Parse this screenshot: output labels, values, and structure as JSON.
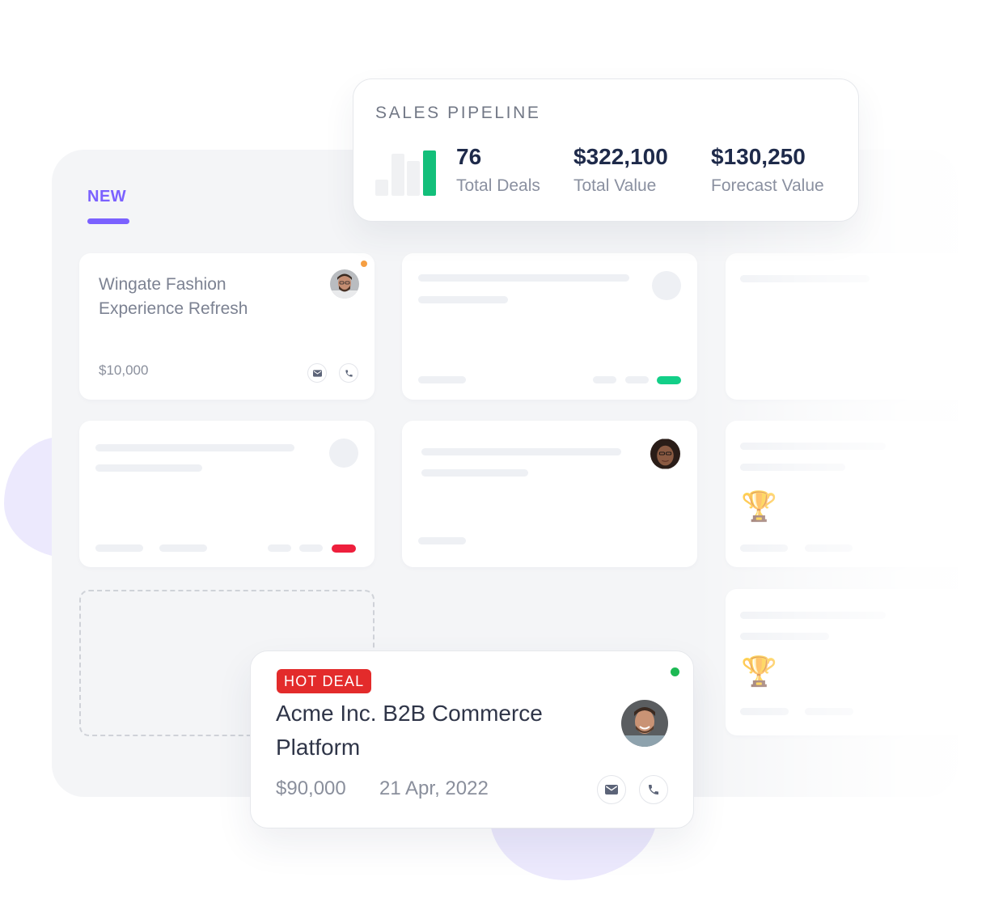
{
  "colors": {
    "accent": "#7b61ff",
    "success": "#13bf7a",
    "danger": "#e32b2b",
    "warning": "#f59e42",
    "online": "#1db954"
  },
  "pipeline": {
    "title": "SALES PIPELINE",
    "bars": [
      {
        "value": 0.36,
        "highlight": false
      },
      {
        "value": 0.93,
        "highlight": false
      },
      {
        "value": 0.77,
        "highlight": false
      },
      {
        "value": 1.0,
        "highlight": true
      }
    ],
    "stats": [
      {
        "value": "76",
        "label": "Total Deals"
      },
      {
        "value": "$322,100",
        "label": "Total Value"
      },
      {
        "value": "$130,250",
        "label": "Forecast Value"
      }
    ]
  },
  "board": {
    "column_title": "NEW",
    "cards": [
      {
        "title": "Wingate Fashion Experience Refresh",
        "amount": "$10,000",
        "status": "warning",
        "icons": [
          "mail-icon",
          "phone-icon"
        ]
      }
    ],
    "placeholder_statuses": [
      "success",
      "danger"
    ],
    "trophy_icon": "🏆"
  },
  "hot_deal": {
    "badge": "HOT DEAL",
    "title": "Acme Inc. B2B Commerce Platform",
    "amount": "$90,000",
    "date": "21 Apr, 2022",
    "status": "online",
    "icons": [
      "mail-icon",
      "phone-icon"
    ]
  }
}
